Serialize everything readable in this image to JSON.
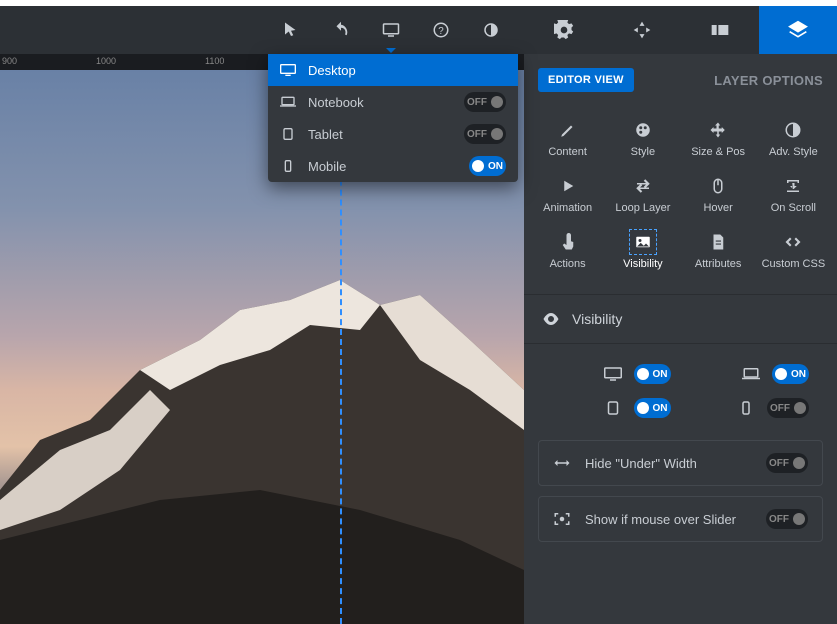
{
  "toolbar": {
    "devices": [
      {
        "name": "Desktop",
        "state": "on",
        "selected": true
      },
      {
        "name": "Notebook",
        "state": "off",
        "selected": false
      },
      {
        "name": "Tablet",
        "state": "off",
        "selected": false
      },
      {
        "name": "Mobile",
        "state": "on",
        "selected": false
      }
    ]
  },
  "ruler": {
    "ticks": [
      "900",
      "1000",
      "1100"
    ]
  },
  "sidepanel": {
    "badge": "EDITOR VIEW",
    "title": "LAYER OPTIONS",
    "props": [
      "Content",
      "Style",
      "Size & Pos",
      "Adv. Style",
      "Animation",
      "Loop Layer",
      "Hover",
      "On Scroll",
      "Actions",
      "Visibility",
      "Attributes",
      "Custom CSS"
    ],
    "section": "Visibility",
    "visibility": [
      {
        "device": "desktop",
        "state": "on"
      },
      {
        "device": "notebook",
        "state": "on"
      },
      {
        "device": "tablet",
        "state": "on"
      },
      {
        "device": "mobile",
        "state": "off"
      }
    ],
    "rows": [
      {
        "label": "Hide \"Under\" Width",
        "state": "off"
      },
      {
        "label": "Show if mouse over Slider",
        "state": "off"
      }
    ]
  },
  "labels": {
    "on": "ON",
    "off": "OFF"
  }
}
